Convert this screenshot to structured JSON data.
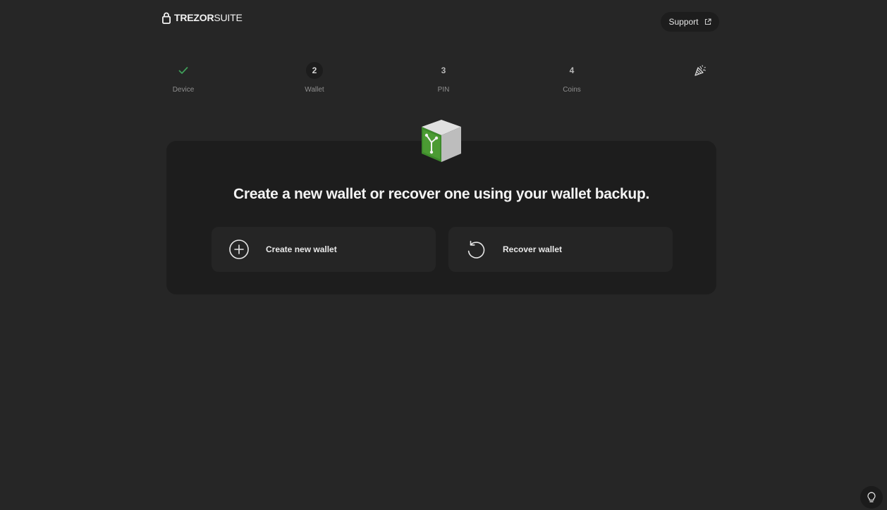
{
  "header": {
    "logo_bold": "TREZOR",
    "logo_light": "SUITE",
    "support_label": "Support"
  },
  "stepper": {
    "steps": [
      {
        "indicator": "",
        "label": "Device",
        "state": "completed",
        "icon": "check-icon"
      },
      {
        "indicator": "2",
        "label": "Wallet",
        "state": "active"
      },
      {
        "indicator": "3",
        "label": "PIN",
        "state": "upcoming"
      },
      {
        "indicator": "4",
        "label": "Coins",
        "state": "upcoming"
      },
      {
        "indicator": "",
        "label": "",
        "state": "final",
        "icon": "party-popper-icon"
      }
    ]
  },
  "card": {
    "title": "Create a new wallet or recover one using your wallet backup.",
    "options": [
      {
        "label": "Create new wallet",
        "icon": "plus-circle-icon"
      },
      {
        "label": "Recover wallet",
        "icon": "recover-arrow-icon"
      }
    ]
  },
  "colors": {
    "background": "#262626",
    "card": "#1d1d1d",
    "option": "#252525",
    "accent_green": "#3fa05a"
  }
}
